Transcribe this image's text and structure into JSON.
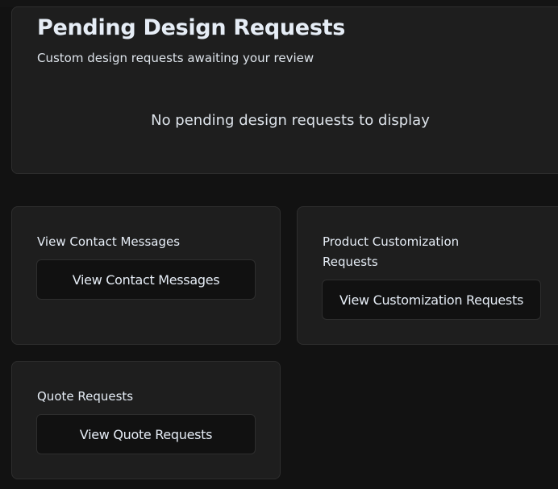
{
  "pending": {
    "title": "Pending Design Requests",
    "subtitle": "Custom design requests awaiting your review",
    "empty_message": "No pending design requests to display"
  },
  "cards": [
    {
      "title": "View Contact Messages",
      "button": "View Contact Messages"
    },
    {
      "title": "Product Customization Requests",
      "button": "View Customization Requests"
    },
    {
      "title": "Quote Requests",
      "button": "View Quote Requests"
    }
  ]
}
